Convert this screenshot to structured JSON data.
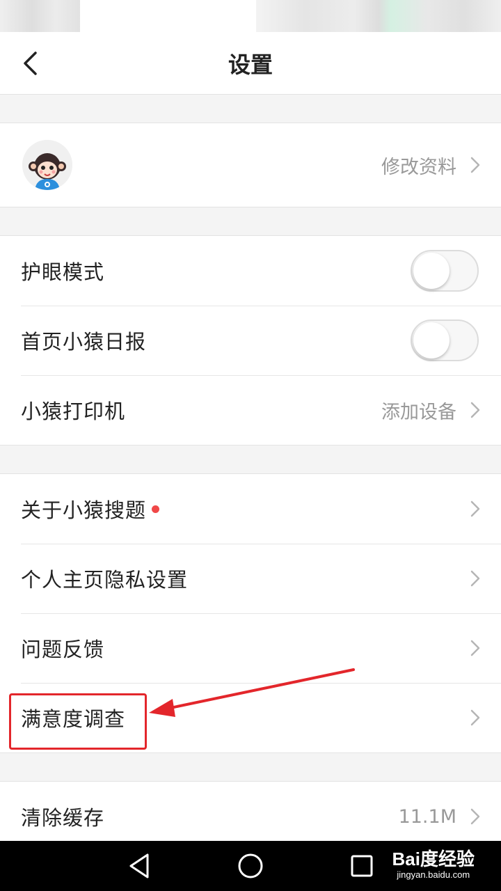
{
  "header": {
    "title": "设置"
  },
  "profile": {
    "edit_label": "修改资料",
    "avatar_icon": "monkey-mascot-icon"
  },
  "group1": {
    "items": [
      {
        "label": "护眼模式",
        "toggle_on": false
      },
      {
        "label": "首页小猿日报",
        "toggle_on": false
      },
      {
        "label": "小猿打印机",
        "value": "添加设备"
      }
    ]
  },
  "group2": {
    "items": [
      {
        "label": "关于小猿搜题",
        "has_dot": true
      },
      {
        "label": "个人主页隐私设置"
      },
      {
        "label": "问题反馈"
      },
      {
        "label": "满意度调查"
      }
    ]
  },
  "group3": {
    "items": [
      {
        "label": "清除缓存",
        "value": "11.1M"
      }
    ]
  },
  "watermark": {
    "logo": "Bai度经验",
    "url": "jingyan.baidu.com"
  },
  "colors": {
    "accent_red": "#e3262b",
    "notification_dot": "#f04848",
    "secondary_text": "#999999",
    "background": "#f4f4f4"
  }
}
